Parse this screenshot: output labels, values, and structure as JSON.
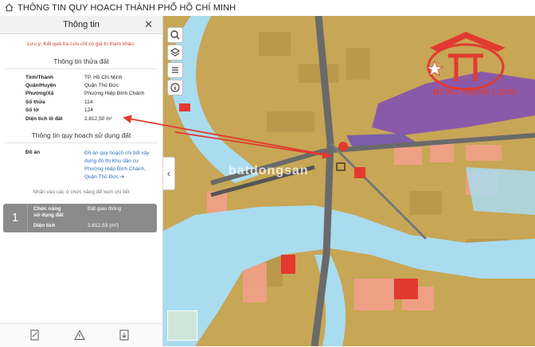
{
  "app": {
    "title": "THÔNG TIN QUY HOẠCH THÀNH PHỐ HỒ CHÍ MINH"
  },
  "panel": {
    "title": "Thông tin",
    "note": "Lưu ý: Kết quả tra cứu chỉ có giá trị tham khảo.",
    "parcel_section": "Thông tin thửa đất",
    "parcel": [
      {
        "k": "Tỉnh/Thành",
        "v": "TP. Hồ Chí Minh"
      },
      {
        "k": "Quận/Huyện",
        "v": "Quận Thủ Đức"
      },
      {
        "k": "Phường/Xã",
        "v": "Phường Hiệp Bình Chánh"
      },
      {
        "k": "Số thửa",
        "v": "114"
      },
      {
        "k": "Số tờ",
        "v": "124"
      },
      {
        "k": "Diện tích lô đất",
        "v": "2.812,50 m²"
      }
    ],
    "plan_section": "Thông tin quy hoạch sử dụng đất",
    "plan_label": "Đồ án",
    "plan_link": "Đồ án quy hoạch chi tiết xây dựng đô thị Khu dân cư Phường Hiệp Bình Chánh, Quận Thủ Đức ➔",
    "hint": "Nhấn vào các ô chức năng để xem chi tiết",
    "card": {
      "num": "1",
      "func_label": "Chức năng sử dụng đất",
      "func_value": "Đất giao thông",
      "area_label": "Diện tích",
      "area_value": "2.812,53 (m²)"
    }
  },
  "map": {
    "logo_text": "HƯNG THỊNH LAND",
    "watermark": "batdongsan",
    "controls": [
      "search-icon",
      "layers-icon",
      "list-icon",
      "info-icon"
    ]
  },
  "colors": {
    "land_yellow": "#c7a656",
    "water": "#a9dcef",
    "residential_pink": "#f2a08a",
    "road": "#6a6a6a",
    "accent_red": "#e23a2e"
  }
}
